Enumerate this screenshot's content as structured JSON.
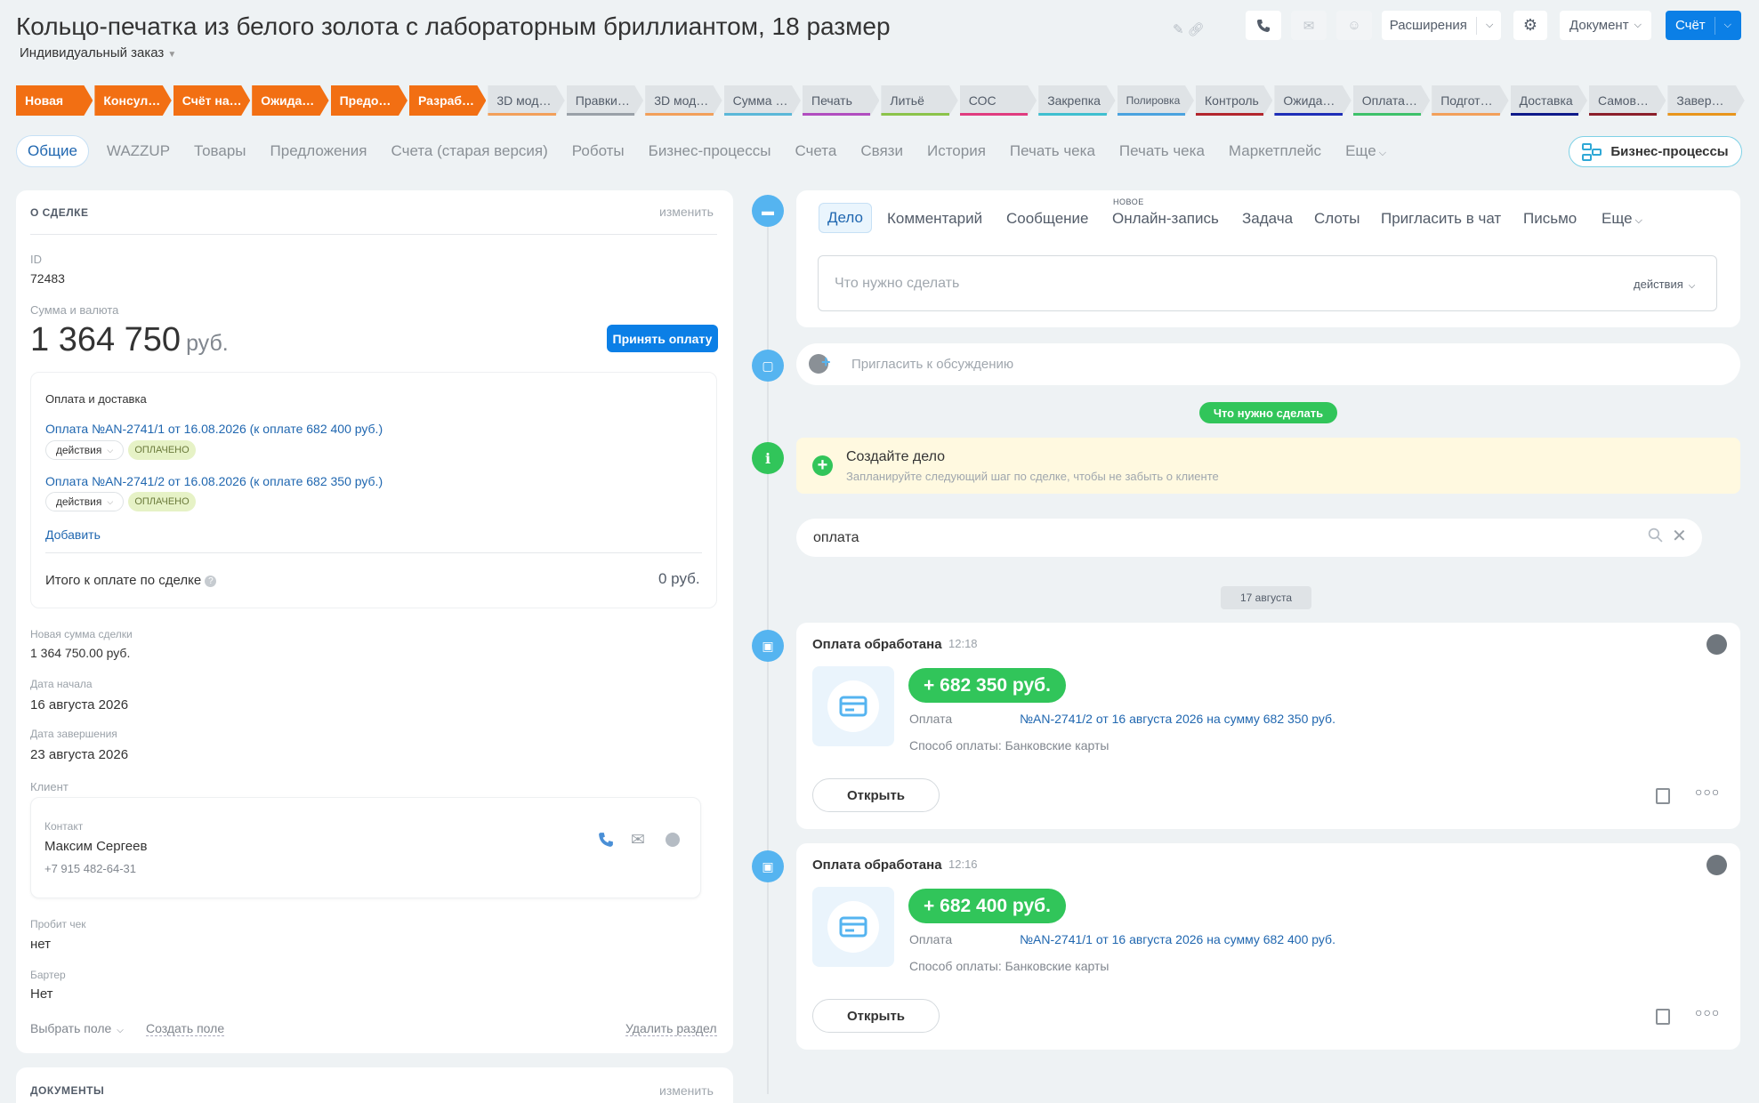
{
  "header": {
    "title": "Кольцо-печатка из белого золота с лабораторным бриллиантом, 18 размер",
    "subtitle": "Индивидуальный заказ",
    "buttons": {
      "extensions": "Расширения",
      "document": "Документ",
      "invoice": "Счёт"
    }
  },
  "stages": [
    {
      "label": "Новая",
      "state": "active",
      "color": "#f26f13"
    },
    {
      "label": "Консул…",
      "state": "active",
      "color": "#f26f13"
    },
    {
      "label": "Счёт на…",
      "state": "active",
      "color": "#f26f13"
    },
    {
      "label": "Ожида…",
      "state": "active",
      "color": "#f26f13"
    },
    {
      "label": "Предо…",
      "state": "active",
      "color": "#f26f13"
    },
    {
      "label": "Разраб…",
      "state": "active",
      "color": "#f26f13"
    },
    {
      "label": "3D мод…",
      "state": "inactive",
      "color": "#f2a05a"
    },
    {
      "label": "Правки…",
      "state": "inactive",
      "color": "#9aa1a8"
    },
    {
      "label": "3D мод…",
      "state": "inactive",
      "color": "#f2a05a"
    },
    {
      "label": "Сумма …",
      "state": "inactive",
      "color": "#5bb8d8"
    },
    {
      "label": "Печать",
      "state": "inactive",
      "color": "#b14dbf"
    },
    {
      "label": "Литьё",
      "state": "inactive",
      "color": "#8bc34a"
    },
    {
      "label": "СОС",
      "state": "inactive",
      "color": "#e03c7f"
    },
    {
      "label": "Закрепка",
      "state": "inactive",
      "color": "#3fbfd0"
    },
    {
      "label": "Полировка",
      "state": "inactive",
      "color": "#4aa3df"
    },
    {
      "label": "Контроль",
      "state": "inactive",
      "color": "#b3262d"
    },
    {
      "label": "Ожида…",
      "state": "inactive",
      "color": "#1e2fb8"
    },
    {
      "label": "Оплата…",
      "state": "inactive",
      "color": "#3ec16a"
    },
    {
      "label": "Подгот…",
      "state": "inactive",
      "color": "#f2a05a"
    },
    {
      "label": "Доставка",
      "state": "inactive",
      "color": "#0e1a8a"
    },
    {
      "label": "Самов…",
      "state": "inactive",
      "color": "#8b1f2a"
    },
    {
      "label": "Завер…",
      "state": "inactive",
      "color": "#e8951c"
    }
  ],
  "tabs": [
    "Общие",
    "WAZZUP",
    "Товары",
    "Предложения",
    "Счета (старая версия)",
    "Роботы",
    "Бизнес-процессы",
    "Счета",
    "Связи",
    "История",
    "Печать чека",
    "Печать чека",
    "Маркетплейс",
    "Еще"
  ],
  "bp_button": "Бизнес-процессы",
  "deal": {
    "section_title": "О СДЕЛКЕ",
    "edit": "изменить",
    "id_label": "ID",
    "id_value": "72483",
    "sum_label": "Сумма и валюта",
    "sum_value": "1 364 750",
    "currency": "руб.",
    "accept_payment": "Принять оплату",
    "payments_title": "Оплата и доставка",
    "payments": [
      {
        "link": "Оплата №AN-2741/1 от 16.08.2026 (к оплате 682 400 руб.)",
        "actions": "действия",
        "status": "ОПЛАЧЕНО"
      },
      {
        "link": "Оплата №AN-2741/2 от 16.08.2026 (к оплате 682 350 руб.)",
        "actions": "действия",
        "status": "ОПЛАЧЕНО"
      }
    ],
    "add": "Добавить",
    "total_label": "Итого к оплате по сделке",
    "total_value": "0 руб.",
    "new_sum_label": "Новая сумма сделки",
    "new_sum_value": "1 364 750.00 руб.",
    "start_label": "Дата начала",
    "start_value": "16 августа 2026",
    "end_label": "Дата завершения",
    "end_value": "23 августа 2026",
    "client_label": "Клиент",
    "contact_label": "Контакт",
    "contact_name": "Максим Сергеев",
    "contact_phone": "+7 915 482-64-31",
    "receipt_label": "Пробит чек",
    "receipt_value": "нет",
    "barter_label": "Бартер",
    "barter_value": "Нет",
    "choose_field": "Выбрать поле",
    "create_field": "Создать поле",
    "delete_section": "Удалить раздел"
  },
  "documents": {
    "title": "ДОКУМЕНТЫ",
    "edit": "изменить"
  },
  "editor": {
    "tabs": [
      "Дело",
      "Комментарий",
      "Сообщение",
      "Онлайн-запись",
      "Задача",
      "Слоты",
      "Пригласить в чат",
      "Письмо",
      "Еще"
    ],
    "new_badge": "НОВОЕ",
    "placeholder": "Что нужно сделать",
    "actions": "действия"
  },
  "invite_placeholder": "Пригласить к обсуждению",
  "todo_pill": "Что нужно сделать",
  "create_task": {
    "title": "Создайте дело",
    "subtitle": "Запланируйте следующий шаг по сделке, чтобы не забыть о клиенте"
  },
  "search_value": "оплата",
  "date_pill": "17 августа",
  "timeline": [
    {
      "title": "Оплата обработана",
      "time": "12:18",
      "amount": "+ 682 350 руб.",
      "pay_label": "Оплата",
      "pay_link": "№AN-2741/2 от 16 августа 2026 на сумму 682 350 руб.",
      "method": "Способ оплаты: Банковские карты",
      "open": "Открыть"
    },
    {
      "title": "Оплата обработана",
      "time": "12:16",
      "amount": "+ 682 400 руб.",
      "pay_label": "Оплата",
      "pay_link": "№AN-2741/1 от 16 августа 2026 на сумму 682 400 руб.",
      "method": "Способ оплаты: Банковские карты",
      "open": "Открыть"
    }
  ]
}
